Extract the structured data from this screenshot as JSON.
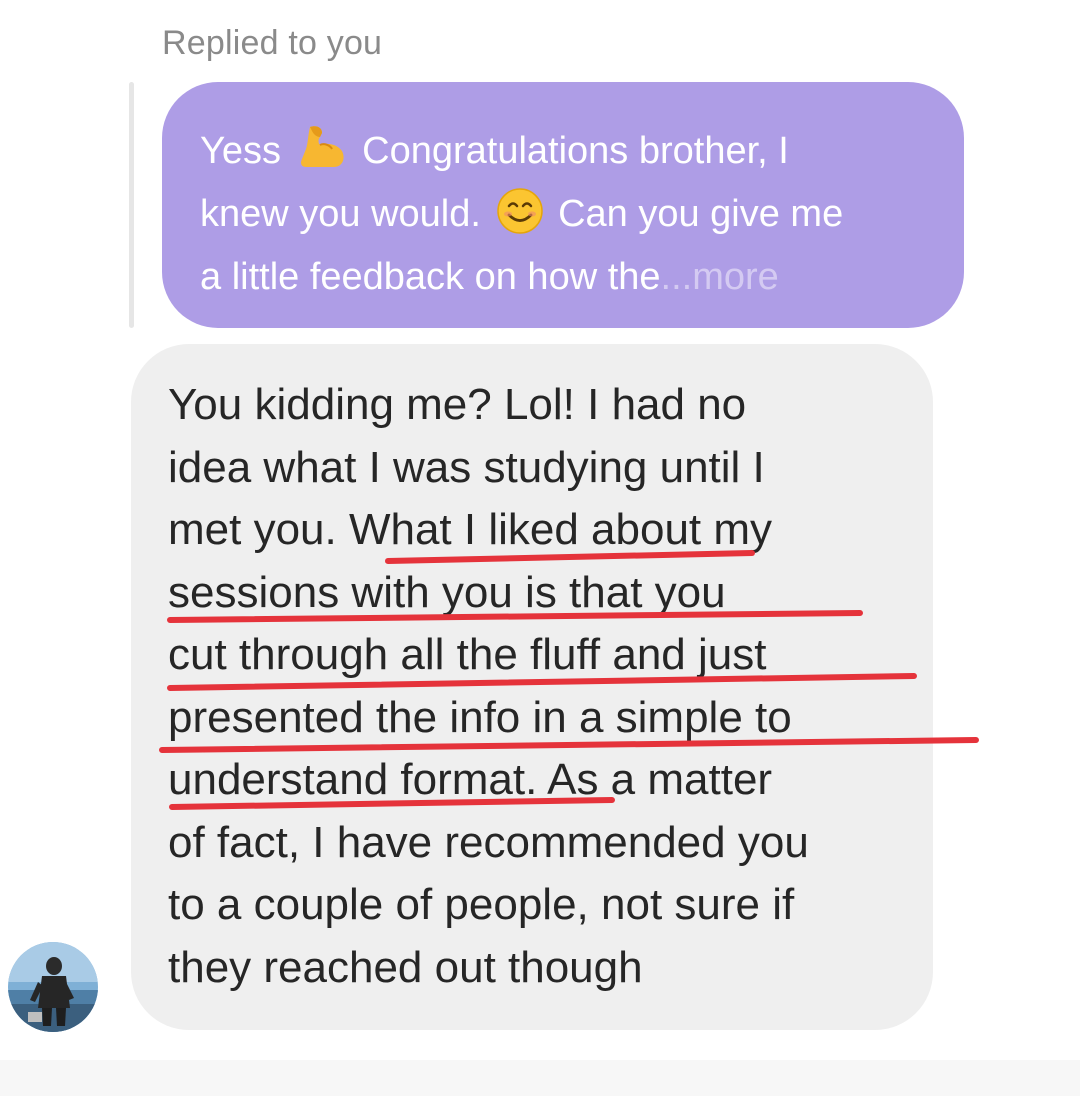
{
  "reply": {
    "header": "Replied to you"
  },
  "quoted_message": {
    "line1_pre": "Yess",
    "line1_post": "Congratulations brother, I",
    "line2_pre": "knew you would.",
    "line2_post": "Can you give me",
    "line3": "a little feedback on how the",
    "more_label": "...more",
    "emoji1": "flexed-biceps-icon",
    "emoji2": "smiling-face-icon"
  },
  "message": {
    "lines": [
      "You kidding me? Lol! I had no",
      "idea what I was studying until I",
      "met you. What I liked about my",
      "sessions with you is that you",
      "cut through all the fluff and just",
      "presented the info in a simple to",
      "understand format. As a matter",
      "of fact, I have recommended you",
      "to a couple of people, not sure if",
      "they reached out though"
    ]
  },
  "colors": {
    "quoted_bubble": "#ae9de6",
    "message_bubble": "#efefef",
    "underline_marker": "#e5333b"
  }
}
